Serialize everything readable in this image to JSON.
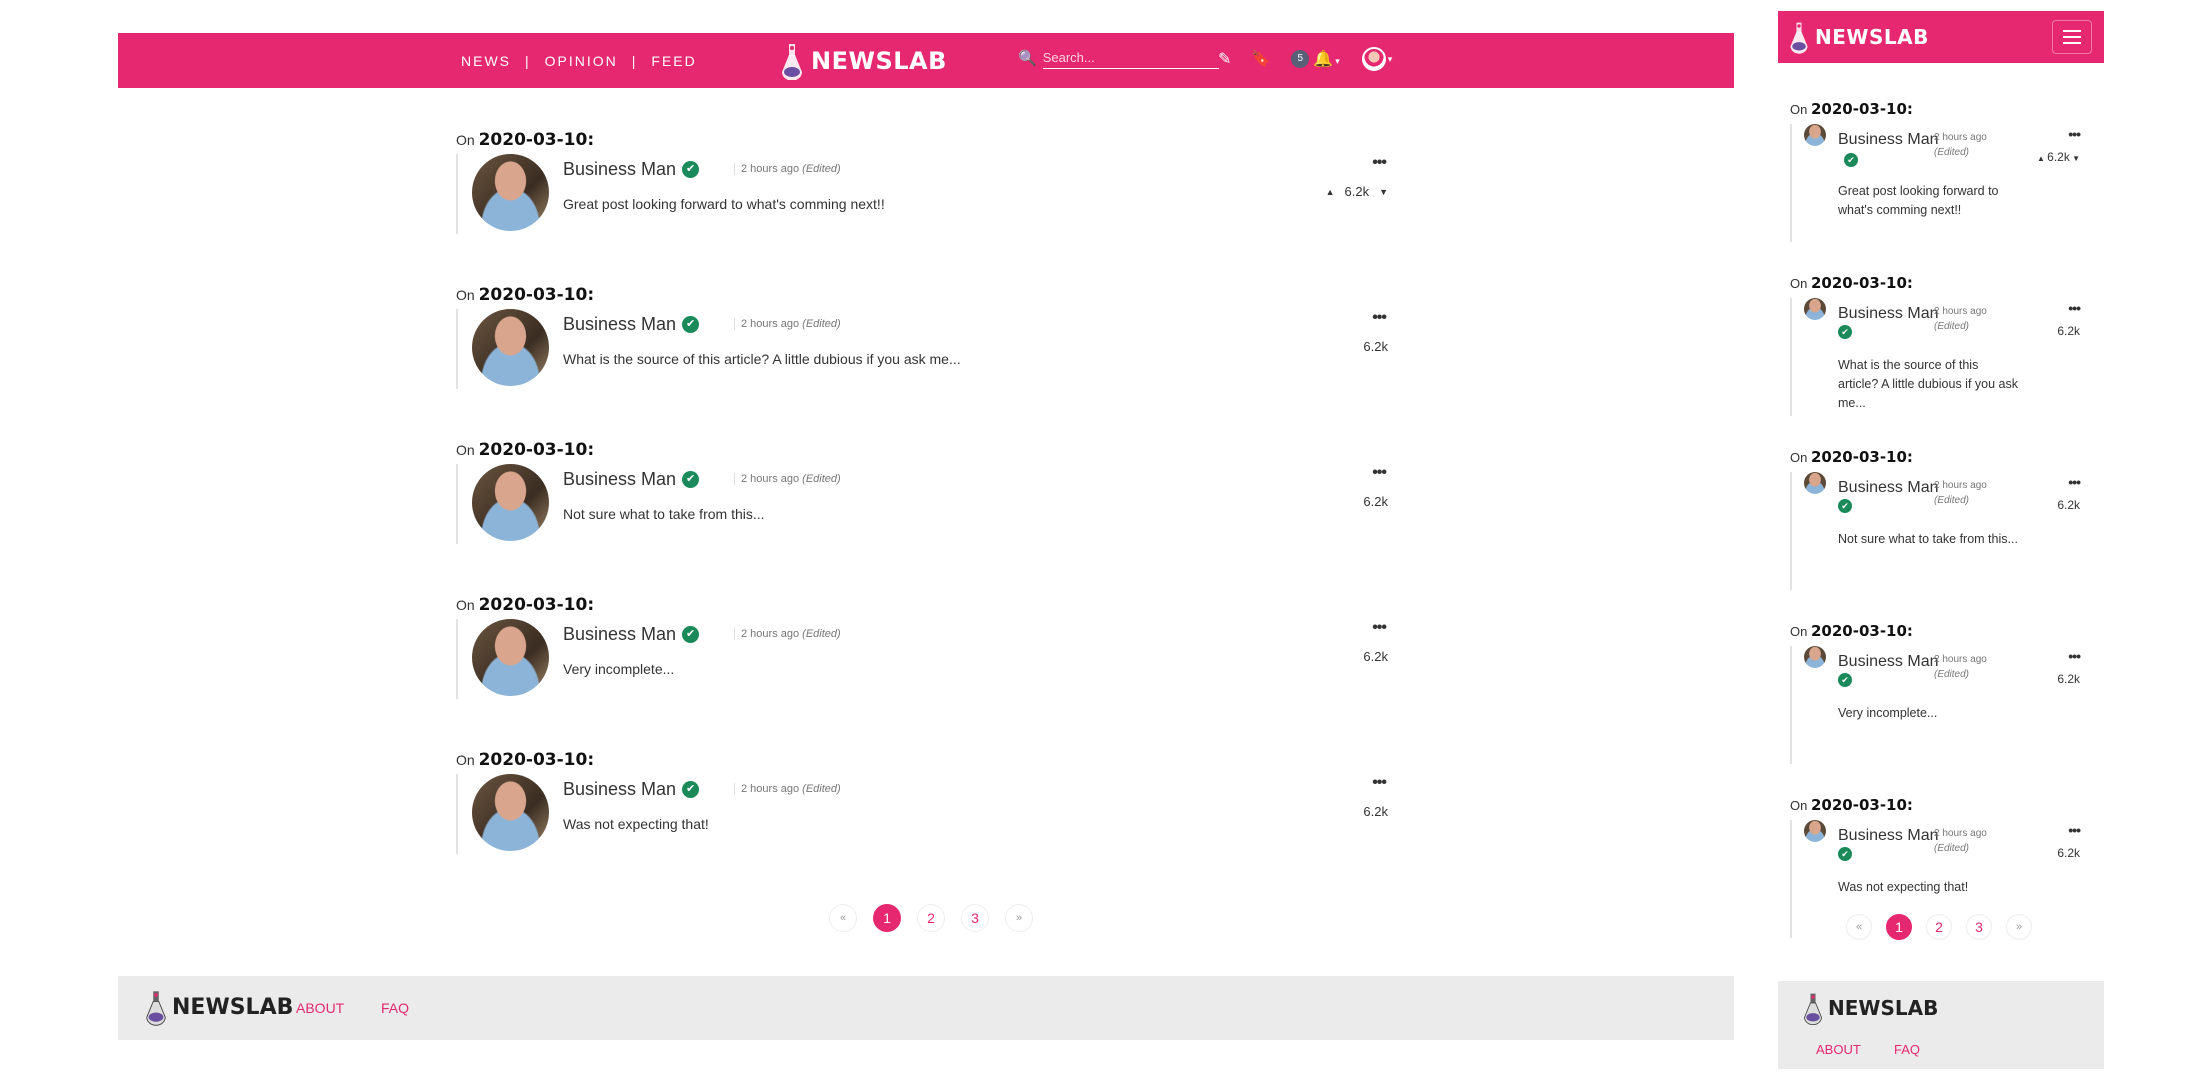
{
  "brand": {
    "name": "NEWSLAB",
    "accent": "#e5286f"
  },
  "nav": {
    "items": [
      "NEWS",
      "OPINION",
      "FEED"
    ]
  },
  "search": {
    "placeholder": "Search..."
  },
  "header": {
    "notification_count": "5"
  },
  "comments": [
    {
      "on_label": "On",
      "date": "2020-03-10:",
      "author": "Business Man",
      "time": "2 hours ago",
      "edited": "(Edited)",
      "text": "Great post looking forward to what's comming next!!",
      "votes": "6.2k",
      "vote_arrows": true
    },
    {
      "on_label": "On",
      "date": "2020-03-10:",
      "author": "Business Man",
      "time": "2 hours ago",
      "edited": "(Edited)",
      "text": "What is the source of this article? A little dubious if you ask me...",
      "votes": "6.2k",
      "vote_arrows": false
    },
    {
      "on_label": "On",
      "date": "2020-03-10:",
      "author": "Business Man",
      "time": "2 hours ago",
      "edited": "(Edited)",
      "text": "Not sure what to take from this...",
      "votes": "6.2k",
      "vote_arrows": false
    },
    {
      "on_label": "On",
      "date": "2020-03-10:",
      "author": "Business Man",
      "time": "2 hours ago",
      "edited": "(Edited)",
      "text": "Very incomplete...",
      "votes": "6.2k",
      "vote_arrows": false
    },
    {
      "on_label": "On",
      "date": "2020-03-10:",
      "author": "Business Man",
      "time": "2 hours ago",
      "edited": "(Edited)",
      "text": "Was not expecting that!",
      "votes": "6.2k",
      "vote_arrows": false
    }
  ],
  "pagination": {
    "prev": "«",
    "pages": [
      "1",
      "2",
      "3"
    ],
    "next": "»",
    "active": "1"
  },
  "footer": {
    "links": [
      "ABOUT",
      "FAQ"
    ]
  }
}
